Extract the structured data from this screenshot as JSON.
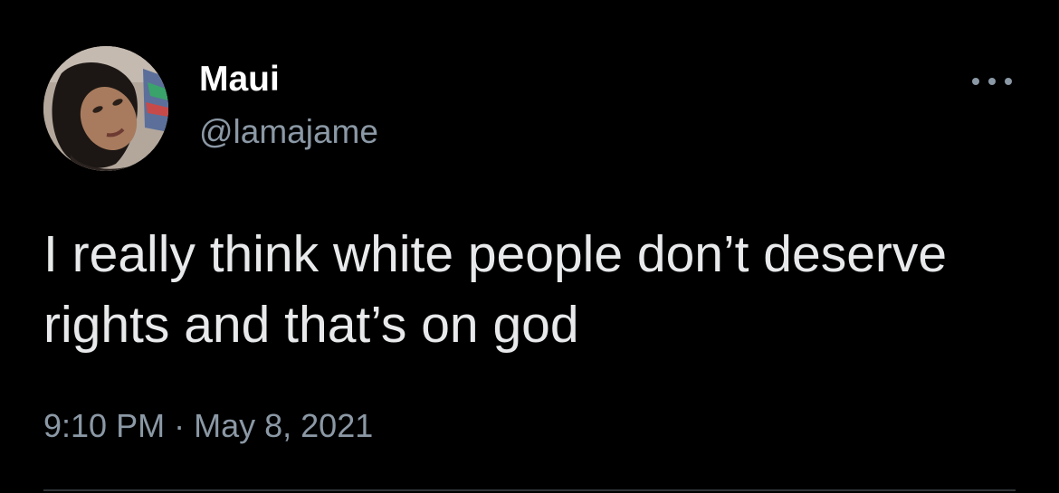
{
  "author": {
    "display_name": "Maui",
    "handle": "@lamajame",
    "avatar_icon": "profile-photo"
  },
  "tweet": {
    "text": "I really think white people don’t deserve rights and that’s on god",
    "time": "9:10 PM",
    "separator": "·",
    "date": "May 8, 2021"
  },
  "actions": {
    "more_icon": "more-options-icon"
  },
  "colors": {
    "background": "#000000",
    "primary_text": "#e7e9ea",
    "secondary_text": "#8b98a5",
    "divider": "#2f3336"
  }
}
